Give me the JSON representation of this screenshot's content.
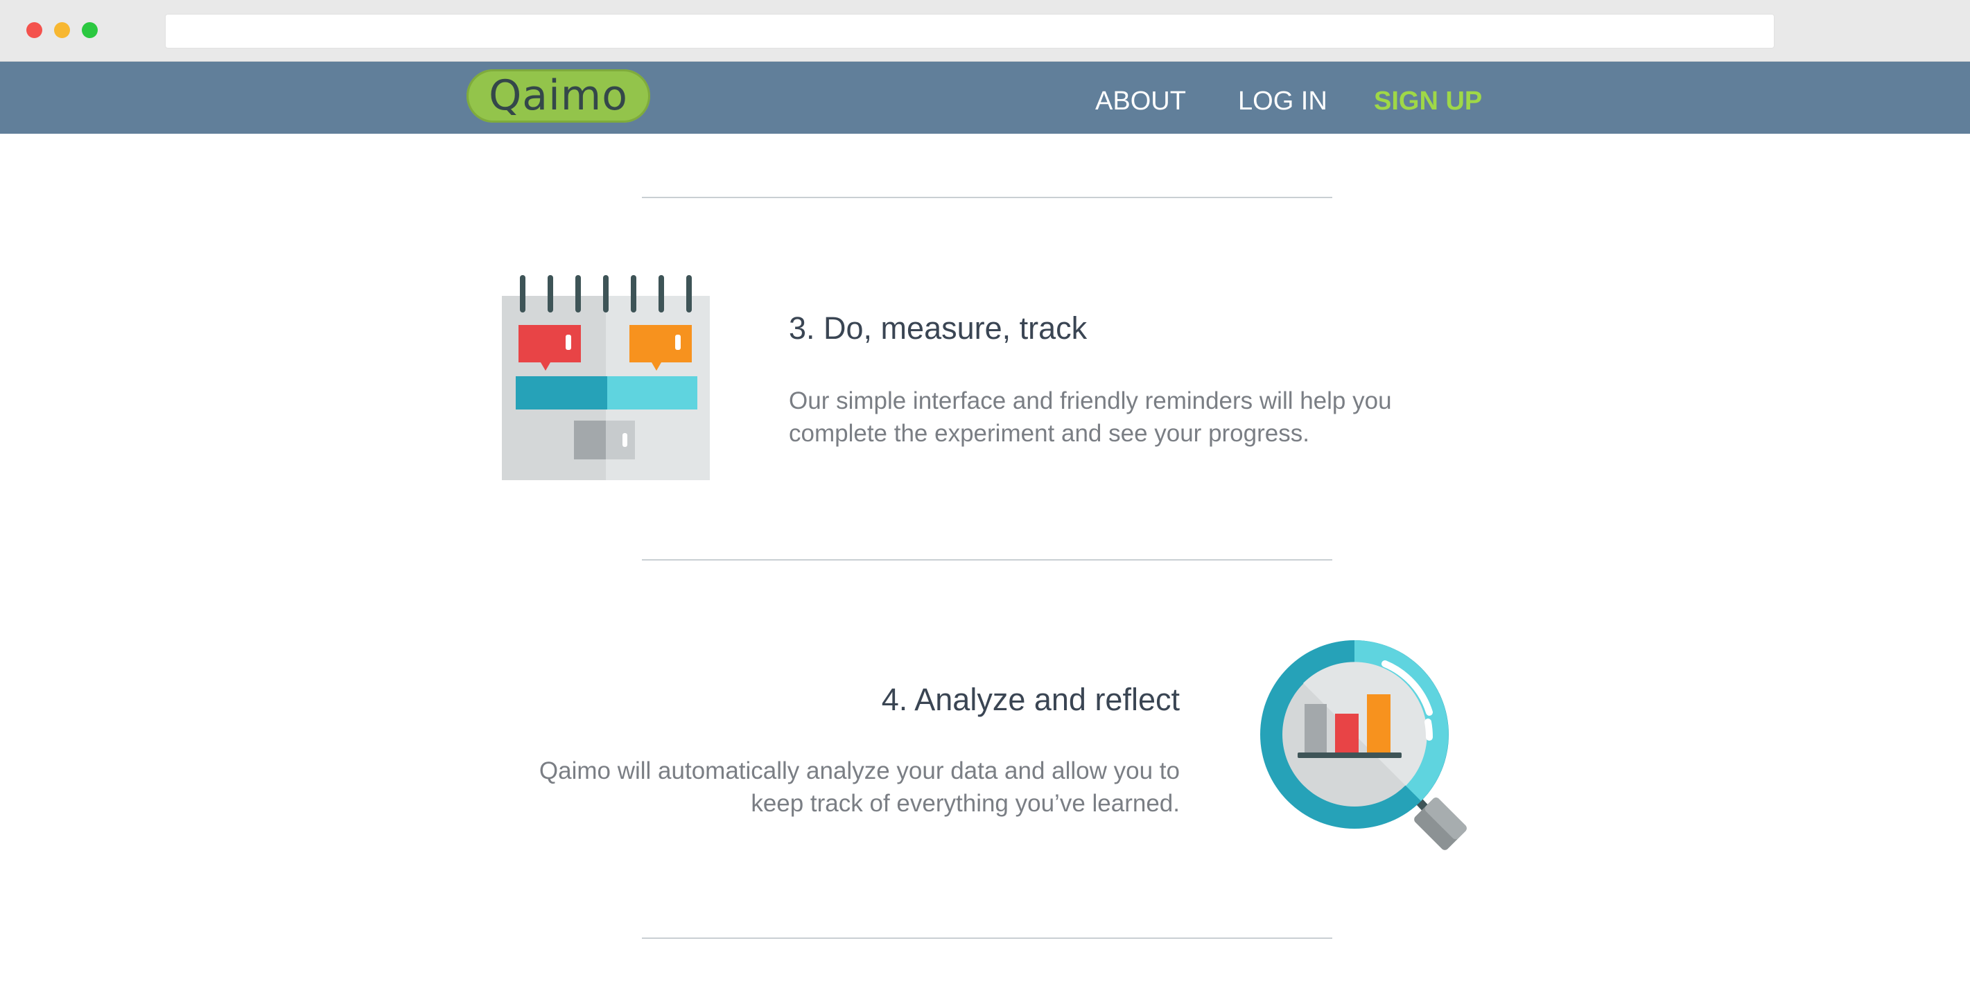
{
  "browser": {
    "address": ""
  },
  "nav": {
    "logo": "Qaimo",
    "links": [
      {
        "label": "ABOUT"
      },
      {
        "label": "LOG IN"
      },
      {
        "label": "SIGN UP"
      }
    ],
    "accent_color": "#9fd847",
    "bar_color": "#617f9a"
  },
  "steps": [
    {
      "number": "3.",
      "title": "3.  Do, measure, track",
      "body": "Our simple interface and friendly reminders will help you complete the experiment and see your progress.",
      "icon": "calendar-icon"
    },
    {
      "number": "4.",
      "title": "4.  Analyze and reflect",
      "body": "Qaimo will automatically analyze your data and allow you to keep track of everything you’ve learned.",
      "icon": "magnifier-chart-icon"
    }
  ]
}
